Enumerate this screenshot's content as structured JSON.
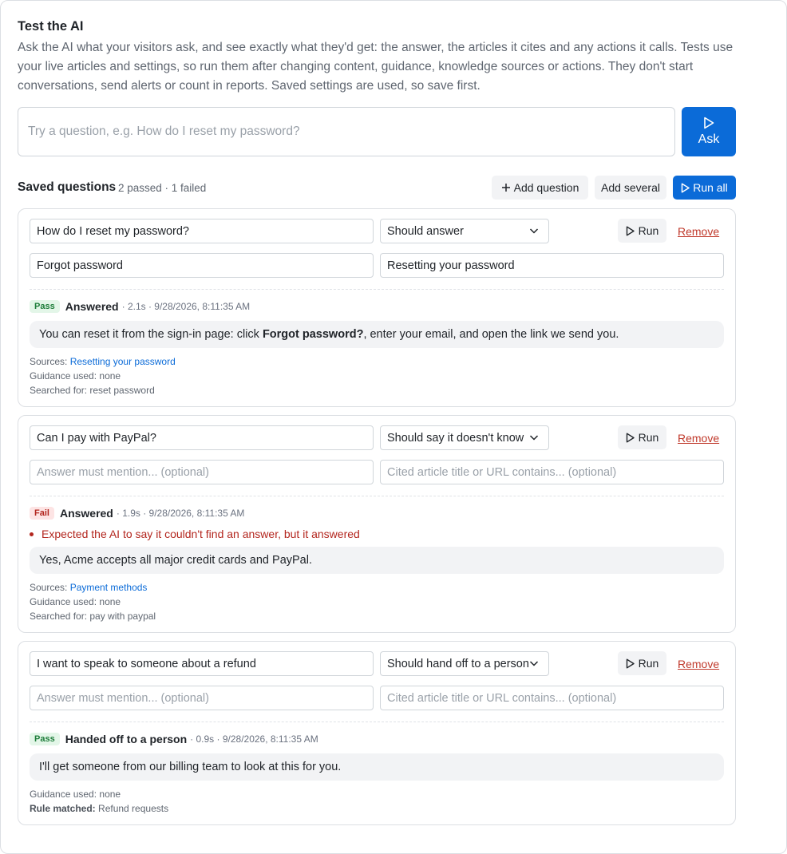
{
  "header": {
    "title": "Test the AI",
    "description": "Ask the AI what your visitors ask, and see exactly what they'd get: the answer, the articles it cites and any actions it calls. Tests use your live articles and settings, so run them after changing content, guidance, knowledge sources or actions. They don't start conversations, send alerts or count in reports. Saved settings are used, so save first."
  },
  "ask": {
    "placeholder": "Try a question, e.g. How do I reset my password?",
    "button_label": "Ask"
  },
  "saved": {
    "title": "Saved questions",
    "summary": "2 passed · 1 failed",
    "add_question_label": "Add question",
    "add_several_label": "Add several",
    "run_all_label": "Run all"
  },
  "labels": {
    "run": "Run",
    "remove": "Remove",
    "sources_prefix": "Sources: ",
    "guidance_prefix": "Guidance used: ",
    "searched_prefix": "Searched for: ",
    "rule_prefix": "Rule matched:"
  },
  "cards": [
    {
      "question": "How do I reset my password?",
      "expectation": "Should answer",
      "mention_value": "Forgot password",
      "mention_placeholder": "Answer must mention... (optional)",
      "cited_value": "Resetting your password",
      "cited_placeholder": "Cited article title or URL contains... (optional)",
      "badge": "Pass",
      "outcome": "Answered",
      "meta": "· 2.1s · 9/28/2026, 8:11:35 AM",
      "answer_before": "You can reset it from the sign-in page: click ",
      "answer_bold": "Forgot password?",
      "answer_after": ", enter your email, and open the link we send you.",
      "source": "Resetting your password",
      "guidance": "none",
      "searched": "reset password"
    },
    {
      "question": "Can I pay with PayPal?",
      "expectation": "Should say it doesn't know",
      "mention_value": "",
      "mention_placeholder": "Answer must mention... (optional)",
      "cited_value": "",
      "cited_placeholder": "Cited article title or URL contains... (optional)",
      "badge": "Fail",
      "outcome": "Answered",
      "meta": "· 1.9s · 9/28/2026, 8:11:35 AM",
      "error": "Expected the AI to say it couldn't find an answer, but it answered",
      "answer": "Yes, Acme accepts all major credit cards and PayPal.",
      "source": "Payment methods",
      "guidance": "none",
      "searched": "pay with paypal"
    },
    {
      "question": "I want to speak to someone about a refund",
      "expectation": "Should hand off to a person",
      "mention_value": "",
      "mention_placeholder": "Answer must mention... (optional)",
      "cited_value": "",
      "cited_placeholder": "Cited article title or URL contains... (optional)",
      "badge": "Pass",
      "outcome": "Handed off to a person",
      "meta": "· 0.9s · 9/28/2026, 8:11:35 AM",
      "answer": "I'll get someone from our billing team to look at this for you.",
      "guidance": "none",
      "rule": "Refund requests"
    }
  ]
}
